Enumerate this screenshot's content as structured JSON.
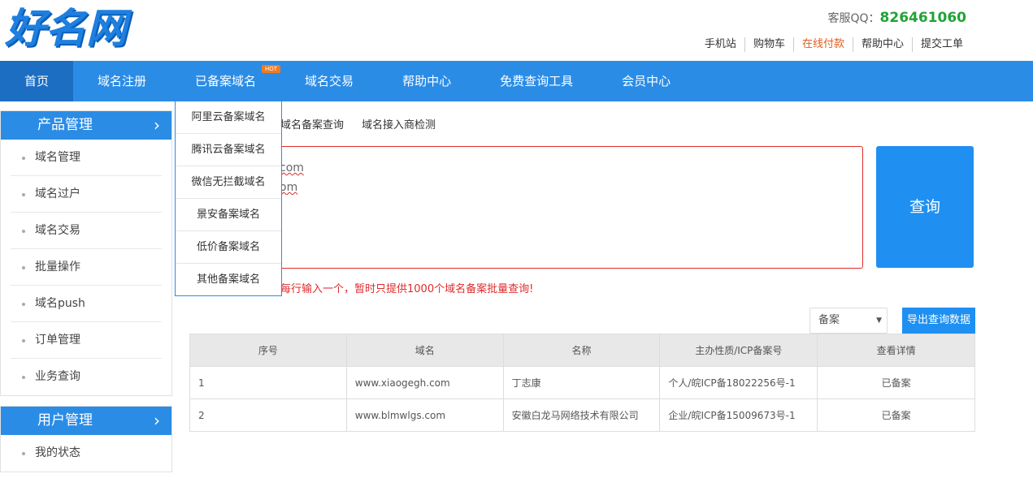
{
  "logo": {
    "text": "好名网"
  },
  "hotline": {
    "label": "客服QQ：",
    "number": "826461060"
  },
  "toplinks": [
    "手机站",
    "购物车",
    "在线付款",
    "帮助中心",
    "提交工单"
  ],
  "nav": {
    "items": [
      "首页",
      "域名注册",
      "已备案域名",
      "域名交易",
      "帮助中心",
      "免费查询工具",
      "会员中心"
    ],
    "hot_badge": "HOT"
  },
  "dropdown": {
    "items": [
      "阿里云备案域名",
      "腾讯云备案域名",
      "微信无拦截域名",
      "景安备案域名",
      "低价备案域名",
      "其他备案域名"
    ]
  },
  "sidebar": {
    "product": {
      "title": "产品管理",
      "items": [
        "域名管理",
        "域名过户",
        "域名交易",
        "批量操作",
        "域名push",
        "订单管理",
        "业务查询"
      ]
    },
    "user": {
      "title": "用户管理",
      "items": [
        "我的状态"
      ]
    }
  },
  "subtabs": [
    "域名备案查询",
    "域名接入商检测"
  ],
  "query": {
    "lines": [
      "com",
      "om"
    ],
    "button": "查询",
    "hint": "每行输入一个，暂时只提供1000个域名备案批量查询!"
  },
  "filter": {
    "selected": "备案",
    "export": "导出查询数据"
  },
  "table": {
    "headers": [
      "序号",
      "域名",
      "名称",
      "主办性质/ICP备案号",
      "查看详情"
    ],
    "rows": [
      [
        "1",
        "www.xiaogegh.com",
        "丁志康",
        "个人/皖ICP备18022256号-1",
        "已备案"
      ],
      [
        "2",
        "www.blmwlgs.com",
        "安徽白龙马网络技术有限公司",
        "企业/皖ICP备15009673号-1",
        "已备案"
      ]
    ]
  }
}
